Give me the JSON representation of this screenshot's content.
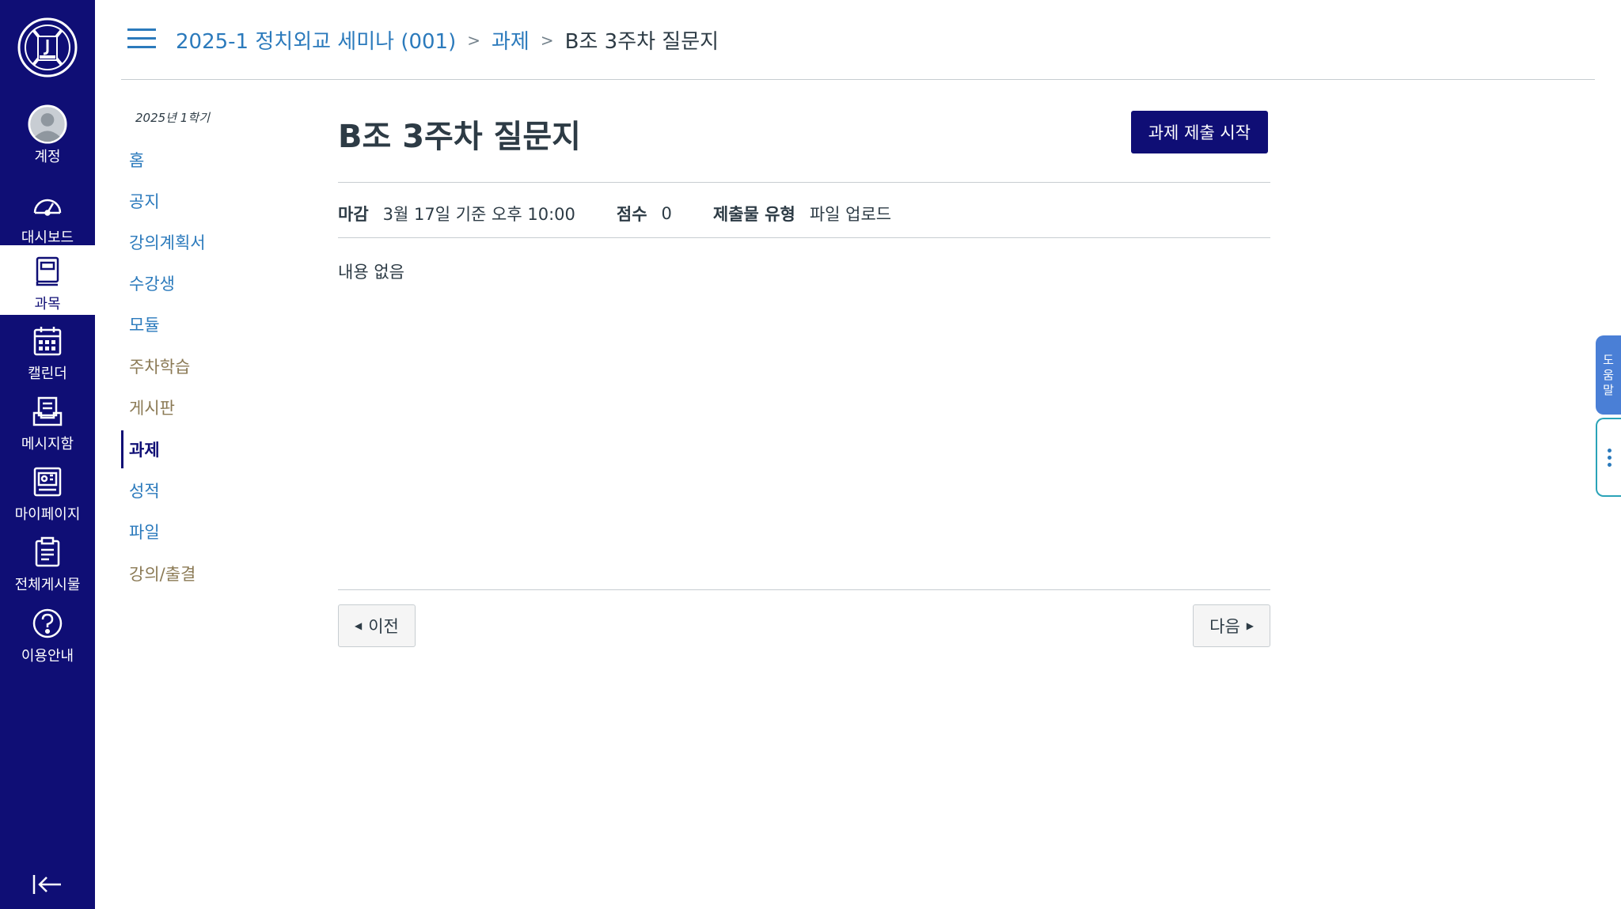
{
  "global_nav": {
    "items": [
      {
        "label": "계정",
        "icon": "account-avatar-icon"
      },
      {
        "label": "대시보드",
        "icon": "dashboard-gauge-icon"
      },
      {
        "label": "과목",
        "icon": "courses-book-icon"
      },
      {
        "label": "캘린더",
        "icon": "calendar-icon"
      },
      {
        "label": "메시지함",
        "icon": "inbox-icon"
      },
      {
        "label": "마이페이지",
        "icon": "mypage-icon"
      },
      {
        "label": "전체게시물",
        "icon": "clipboard-icon"
      },
      {
        "label": "이용안내",
        "icon": "help-question-icon"
      }
    ],
    "active_index": 2,
    "colors": {
      "bg": "#0f0e75",
      "active_bg": "#ffffff"
    }
  },
  "breadcrumb": {
    "course": "2025-1 정치외교 세미나 (001)",
    "section": "과제",
    "current": "B조 3주차 질문지",
    "separator": ">"
  },
  "course_nav": {
    "term": "2025년 1학기",
    "items": [
      {
        "label": "홈"
      },
      {
        "label": "공지"
      },
      {
        "label": "강의계획서"
      },
      {
        "label": "수강생"
      },
      {
        "label": "모듈"
      },
      {
        "label": "주차학습"
      },
      {
        "label": "게시판"
      },
      {
        "label": "과제"
      },
      {
        "label": "성적"
      },
      {
        "label": "파일"
      },
      {
        "label": "강의/출결"
      }
    ]
  },
  "assignment": {
    "title": "B조 3주차 질문지",
    "start_button": "과제 제출 시작",
    "details": {
      "due_label": "마감",
      "due_value": "3월 17일 기준 오후 10:00",
      "points_label": "점수",
      "points_value": "0",
      "type_label": "제출물 유형",
      "type_value": "파일 업로드"
    },
    "description": "내용 없음"
  },
  "pager": {
    "prev": "이전",
    "next": "다음"
  },
  "side_tabs": {
    "help": [
      "도",
      "움",
      "말"
    ]
  }
}
